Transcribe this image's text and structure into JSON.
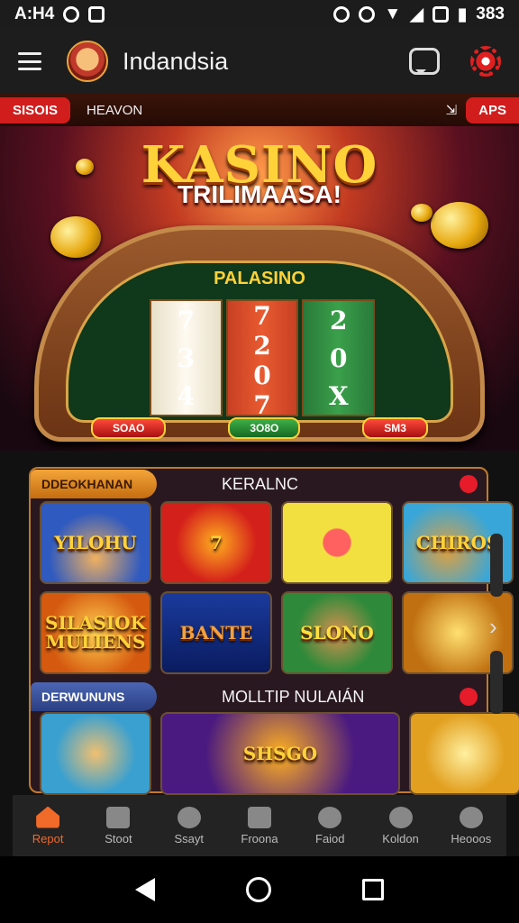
{
  "status": {
    "time": "A:H4",
    "battery": "383"
  },
  "appbar": {
    "title": "Indandsia"
  },
  "ticker": {
    "left_pill": "SISOIS",
    "text": "HEAVON",
    "right_pill": "APS"
  },
  "hero": {
    "title": "KASINO",
    "subtitle": "TRILIMAASA!",
    "machine_title": "PALASINO",
    "reels": [
      [
        "7",
        "3",
        "4"
      ],
      [
        "7",
        "2",
        "0",
        "7"
      ],
      [
        "2",
        "0",
        "X"
      ]
    ],
    "buttons": [
      "SOAO",
      "3O8O",
      "SM3"
    ]
  },
  "sections": [
    {
      "tag": "DDEOKHANAN",
      "title": "KERALNC",
      "tiles": [
        "YILOHU",
        "7",
        "",
        "CHIROS",
        "SILASIOK MULIENS",
        "BANTE",
        "SLONO",
        ""
      ]
    },
    {
      "tag": "DERWUNUNS",
      "title": "MOLLTIP NULAIÁN",
      "tiles": [
        "",
        "SHSGO",
        ""
      ]
    }
  ],
  "bottomnav": [
    {
      "label": "Repot",
      "icon": "home-icon",
      "active": true
    },
    {
      "label": "Stoot",
      "icon": "store-icon"
    },
    {
      "label": "Ssayt",
      "icon": "search-icon"
    },
    {
      "label": "Froona",
      "icon": "dice-icon"
    },
    {
      "label": "Faiod",
      "icon": "chat-icon"
    },
    {
      "label": "Koldon",
      "icon": "gear-icon"
    },
    {
      "label": "Heooos",
      "icon": "search-icon"
    }
  ],
  "colors": {
    "accent": "#f06a2a",
    "red": "#d21d1d",
    "gold": "#ffd23a"
  }
}
